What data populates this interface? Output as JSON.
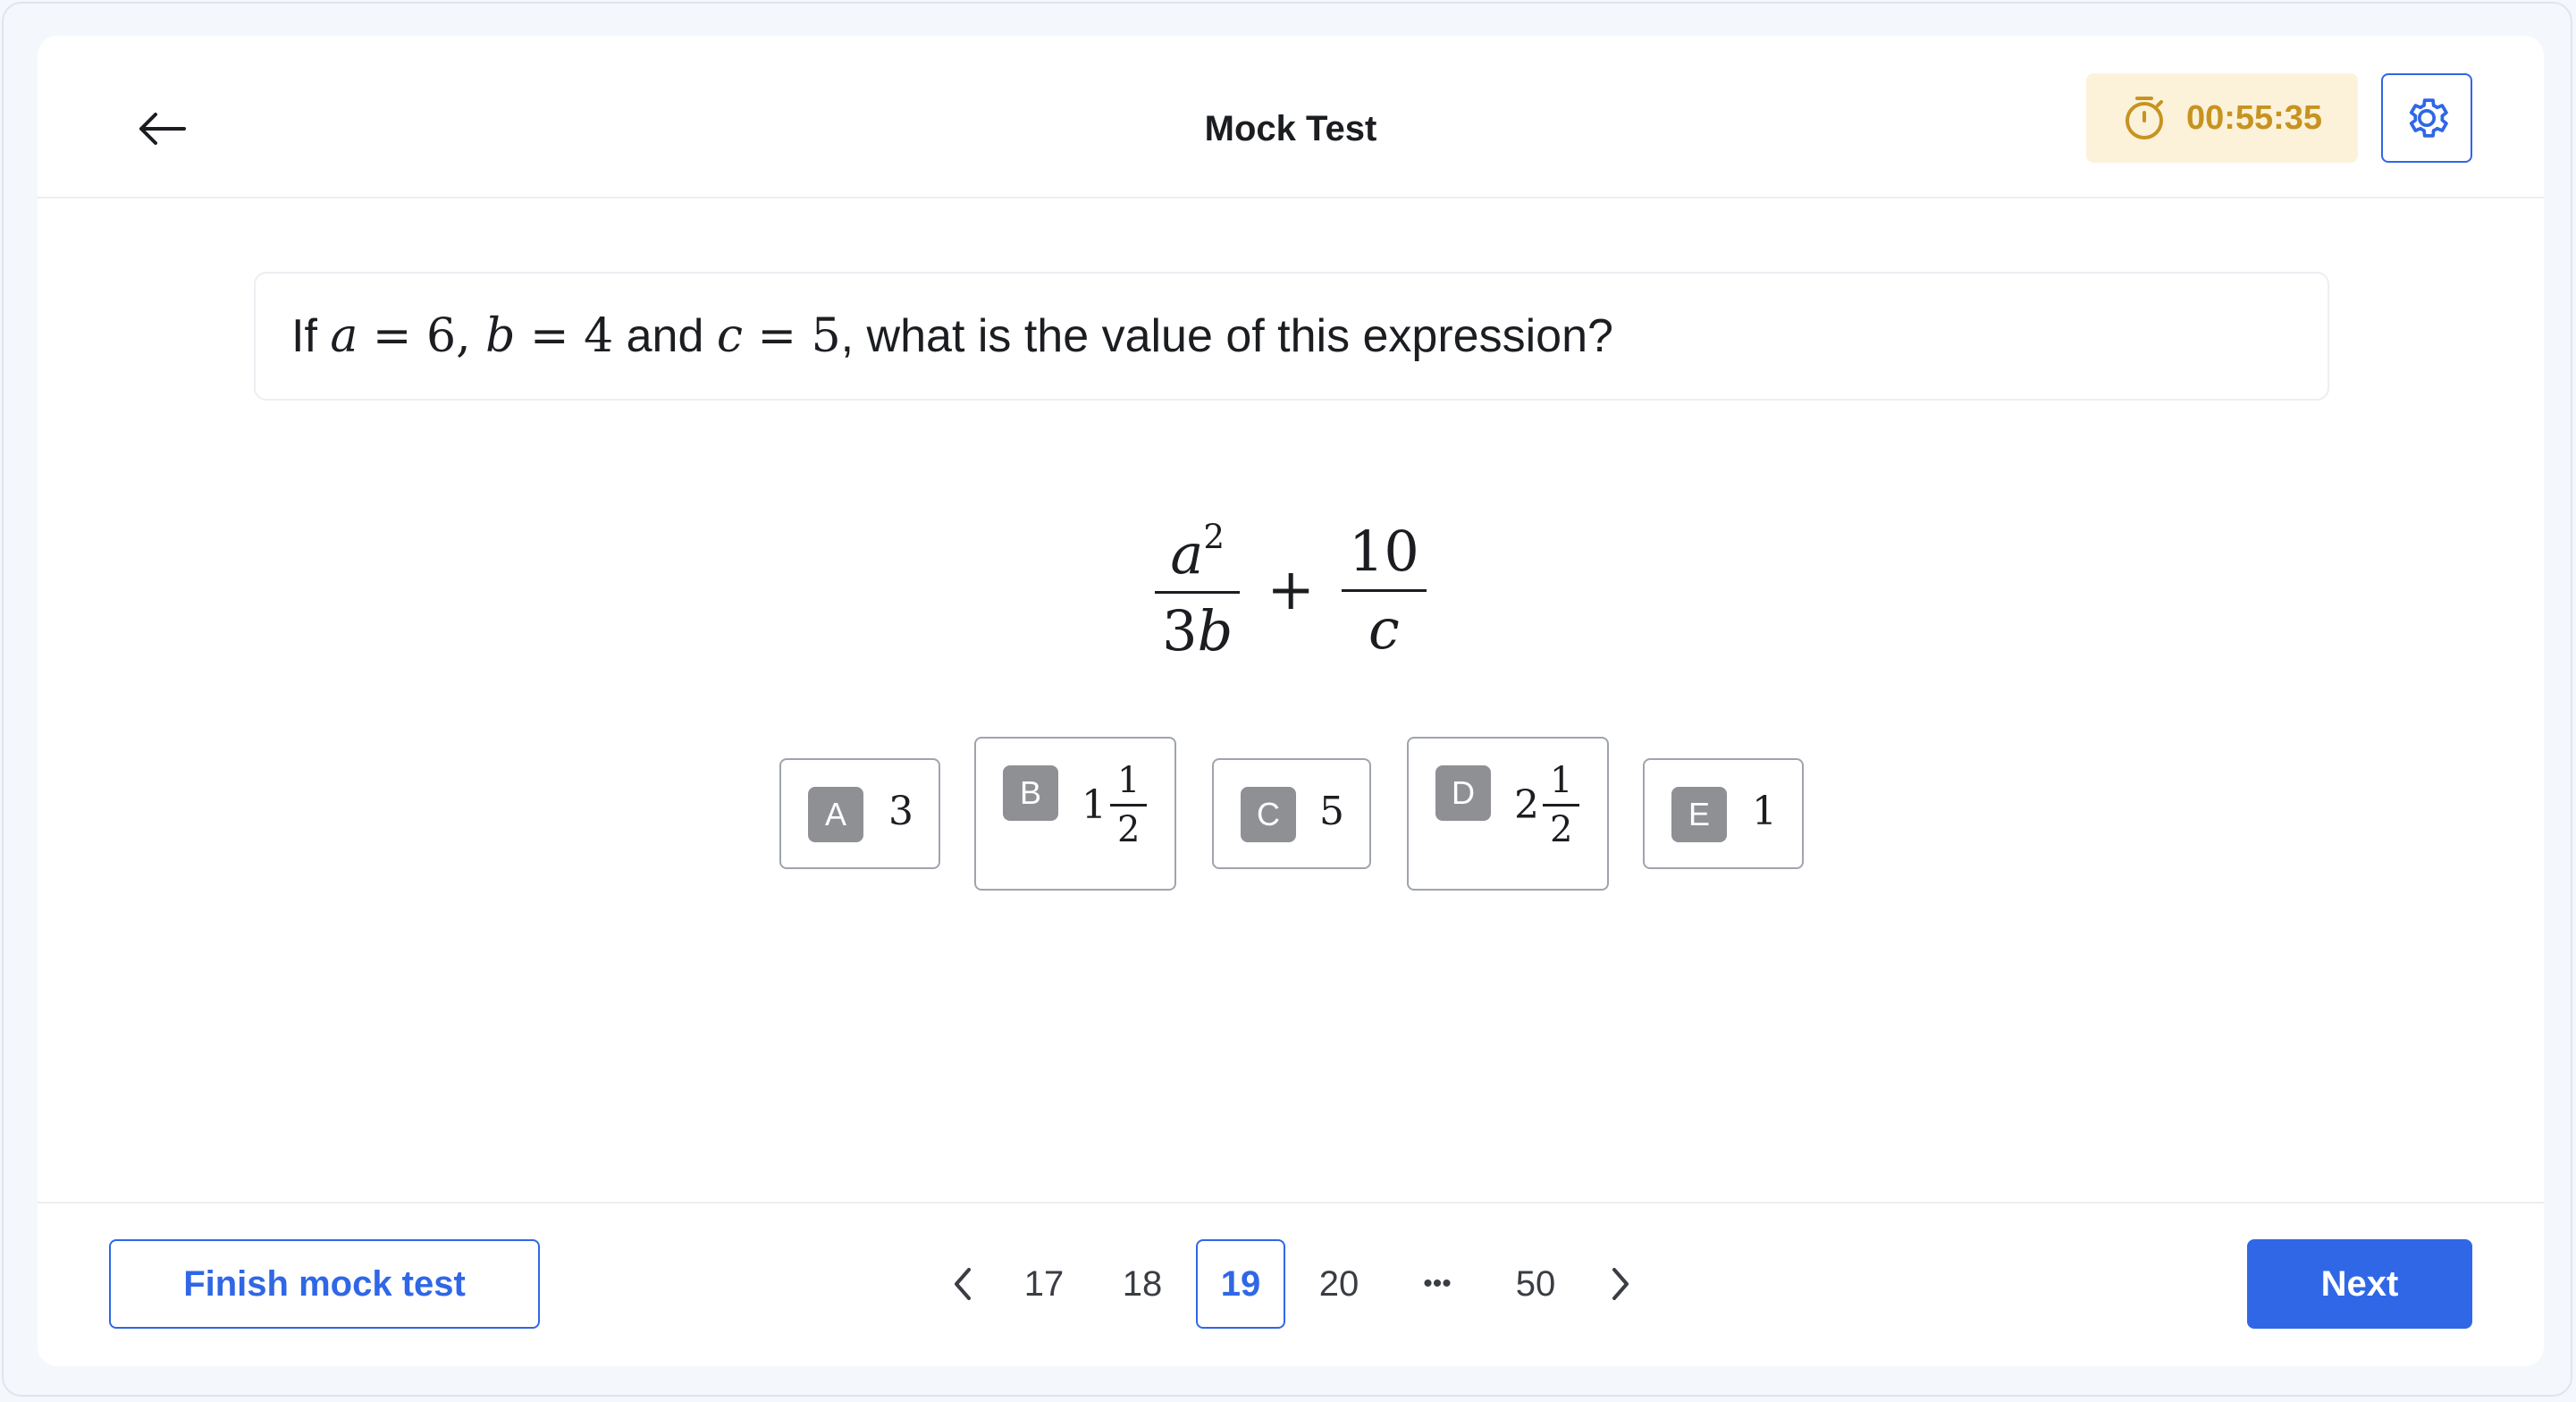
{
  "header": {
    "title": "Mock Test",
    "timer": "00:55:35",
    "colors": {
      "accent": "#2f67e6",
      "timer_bg": "#fcf2da",
      "timer_text": "#c79320"
    }
  },
  "question": {
    "prefix": "If ",
    "var_a": "a",
    "eq_a": " = 6, ",
    "var_b": "b",
    "eq_b": " = 4",
    "mid": " and ",
    "var_c": "c",
    "eq_c": " = 5",
    "suffix": ", what is the value of this expression?"
  },
  "expression": {
    "frac1_num_base": "a",
    "frac1_num_exp": "2",
    "frac1_den_coef": "3",
    "frac1_den_var": "b",
    "plus": "+",
    "frac2_num": "10",
    "frac2_den": "c"
  },
  "options": [
    {
      "letter": "A",
      "whole": "3"
    },
    {
      "letter": "B",
      "whole": "1",
      "num": "1",
      "den": "2"
    },
    {
      "letter": "C",
      "whole": "5"
    },
    {
      "letter": "D",
      "whole": "2",
      "num": "1",
      "den": "2"
    },
    {
      "letter": "E",
      "whole": "1"
    }
  ],
  "footer": {
    "finish_label": "Finish mock test",
    "pages": [
      "17",
      "18",
      "19",
      "20",
      "•••",
      "50"
    ],
    "current_page": "19",
    "next_label": "Next"
  }
}
